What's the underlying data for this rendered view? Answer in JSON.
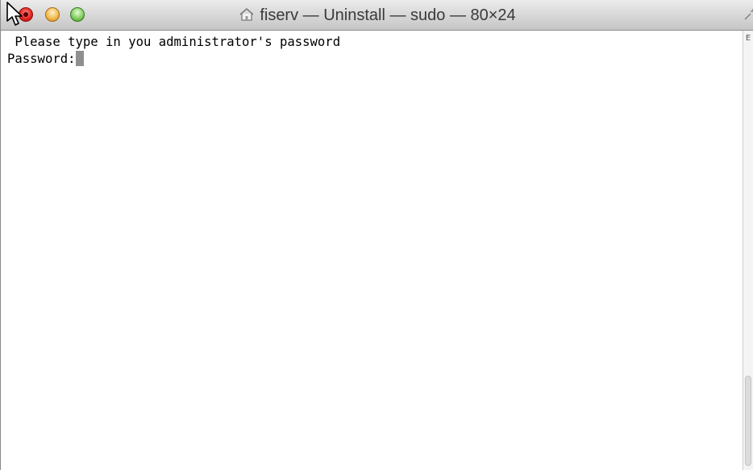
{
  "window": {
    "title": "fiserv — Uninstall — sudo — 80×24",
    "icons": {
      "close": "close-button-icon",
      "minimize": "minimize-button-icon",
      "zoom": "zoom-button-icon",
      "home": "home-folder-icon",
      "resize": "fullscreen-icon",
      "pointer": "mouse-pointer-icon"
    }
  },
  "terminal": {
    "lines": [
      " Please type in you administrator's password",
      "Password:"
    ]
  },
  "scrollbar": {
    "top_glyph": "E"
  }
}
